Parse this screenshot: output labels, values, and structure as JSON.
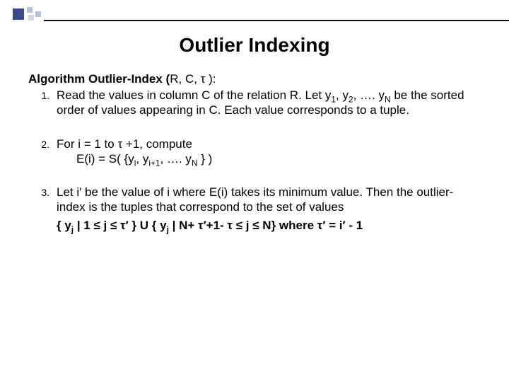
{
  "title": "Outlier Indexing",
  "algo_name": "Algorithm Outlier-Index (",
  "algo_params": "R, C, τ ):",
  "steps": {
    "s1_a": "Read the values in column C of the relation R. Let y",
    "s1_b": ", y",
    "s1_c": ", …. y",
    "s1_d": " be the sorted order of values appearing in C. Each value corresponds to a tuple.",
    "s2_a": "For i = 1 to τ +1, compute",
    "s2_b": "E(i) = S( {y",
    "s2_c": ", y",
    "s2_d": ", …. y",
    "s2_e": " } )",
    "s3_a": "Let i′ be the value of i where E(i) takes its minimum value. Then the outlier-index is the tuples that correspond to the set of values",
    "s3_f": "{ y",
    "s3_g": " | 1 ≤  j  ≤  τ′ } U { y",
    "s3_h": " | N+ τ′+1- τ  ≤  j  ≤  N}  where τ′ = i′ - 1"
  },
  "subs": {
    "one": "1",
    "two": "2",
    "N": "N",
    "i": "i",
    "ip1": "i+1",
    "j": "j"
  }
}
